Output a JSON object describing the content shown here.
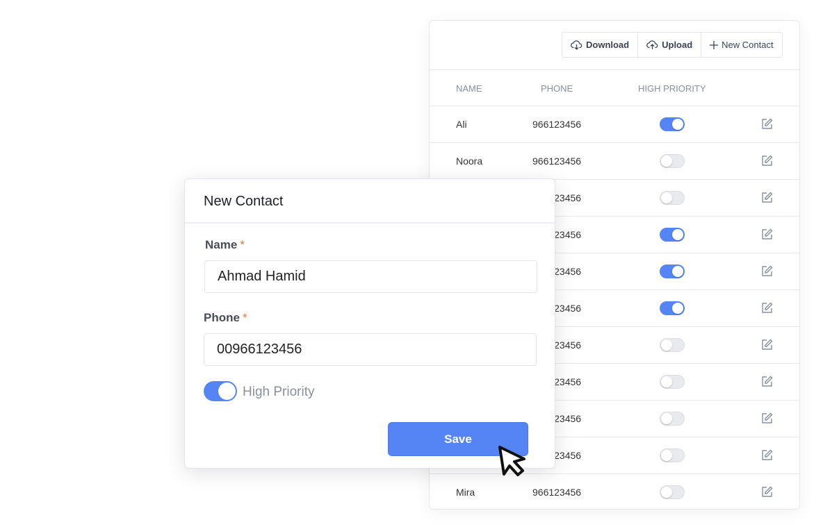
{
  "toolbar": {
    "download": "Download",
    "upload": "Upload",
    "new_contact": "New Contact"
  },
  "table": {
    "headers": [
      "NAME",
      "PHONE",
      "HIGH PRIORITY"
    ],
    "rows": [
      {
        "name": "Ali",
        "phone": "966123456",
        "high_priority": true
      },
      {
        "name": "Noora",
        "phone": "966123456",
        "high_priority": false
      },
      {
        "name": "",
        "phone": "966123456",
        "high_priority": false
      },
      {
        "name": "",
        "phone": "966123456",
        "high_priority": true
      },
      {
        "name": "",
        "phone": "966123456",
        "high_priority": true
      },
      {
        "name": "",
        "phone": "966123456",
        "high_priority": true
      },
      {
        "name": "",
        "phone": "966123456",
        "high_priority": false
      },
      {
        "name": "",
        "phone": "966123456",
        "high_priority": false
      },
      {
        "name": "",
        "phone": "966123456",
        "high_priority": false
      },
      {
        "name": "",
        "phone": "966123456",
        "high_priority": false
      },
      {
        "name": "Mira",
        "phone": "966123456",
        "high_priority": false
      }
    ]
  },
  "modal": {
    "title": "New Contact",
    "name_label": "Name",
    "phone_label": "Phone",
    "required_mark": "*",
    "name_value": "Ahmad Hamid",
    "phone_value": "00966123456",
    "high_priority_label": "High Priority",
    "high_priority": true,
    "save_label": "Save"
  },
  "colors": {
    "accent": "#5585f5",
    "required": "#e07a3b"
  }
}
